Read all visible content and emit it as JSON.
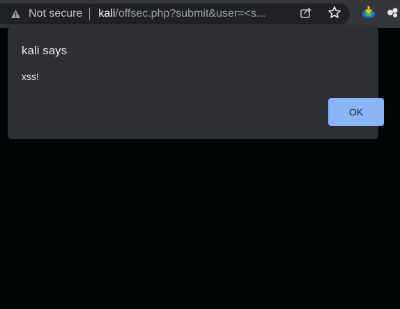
{
  "browser": {
    "security_label": "Not secure",
    "url_host": "kali",
    "url_path": "/offsec.php?submit&user=<s...",
    "icons": [
      "warning-icon",
      "share-icon",
      "bookmark-star-icon",
      "extension-download-icon",
      "extension-icon"
    ]
  },
  "dialog": {
    "title": "kali says",
    "message": "xss!",
    "ok_label": "OK",
    "ok_color": "#8ab4f8"
  }
}
